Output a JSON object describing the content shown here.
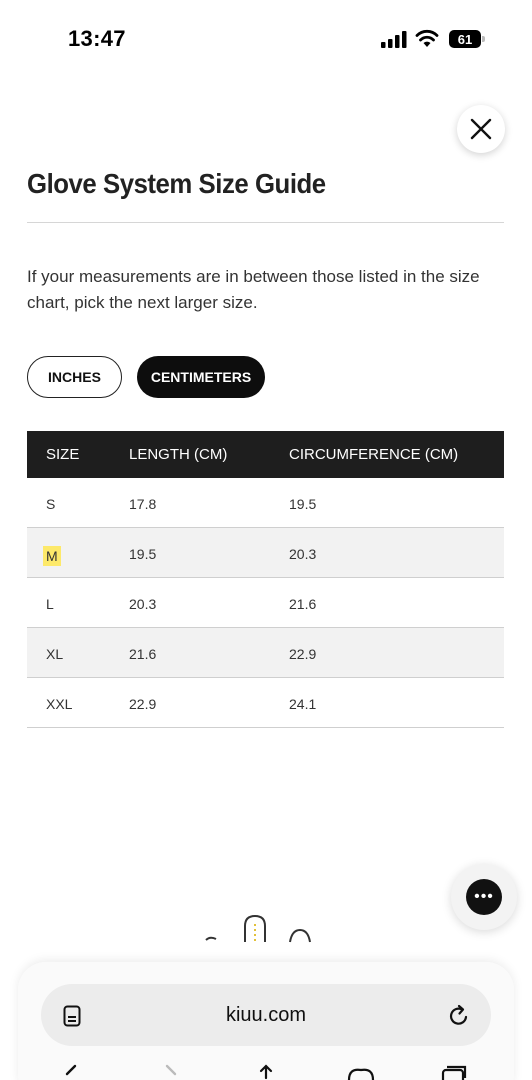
{
  "status_bar": {
    "time": "13:47",
    "battery": "61"
  },
  "page": {
    "title": "Glove System Size Guide",
    "intro": "If your measurements are in between those listed in the size chart, pick the next larger size."
  },
  "units": {
    "inches_label": "INCHES",
    "cm_label": "CENTIMETERS",
    "selected": "CENTIMETERS"
  },
  "table": {
    "headers": [
      "SIZE",
      "LENGTH (CM)",
      "CIRCUMFERENCE (CM)"
    ],
    "rows": [
      {
        "size": "S",
        "length": "17.8",
        "circumference": "19.5"
      },
      {
        "size": "M",
        "length": "19.5",
        "circumference": "20.3"
      },
      {
        "size": "L",
        "length": "20.3",
        "circumference": "21.6"
      },
      {
        "size": "XL",
        "length": "21.6",
        "circumference": "22.9"
      },
      {
        "size": "XXL",
        "length": "22.9",
        "circumference": "24.1"
      }
    ],
    "highlighted_size": "M"
  },
  "chat": {
    "icon": "chat-dots-icon",
    "glyph": "•••"
  },
  "browser": {
    "url": "kiuu.com"
  },
  "colors": {
    "header_bg": "#1e1e1e",
    "selected_unit_bg": "#0d0d0d",
    "highlight": "#fde96a"
  }
}
